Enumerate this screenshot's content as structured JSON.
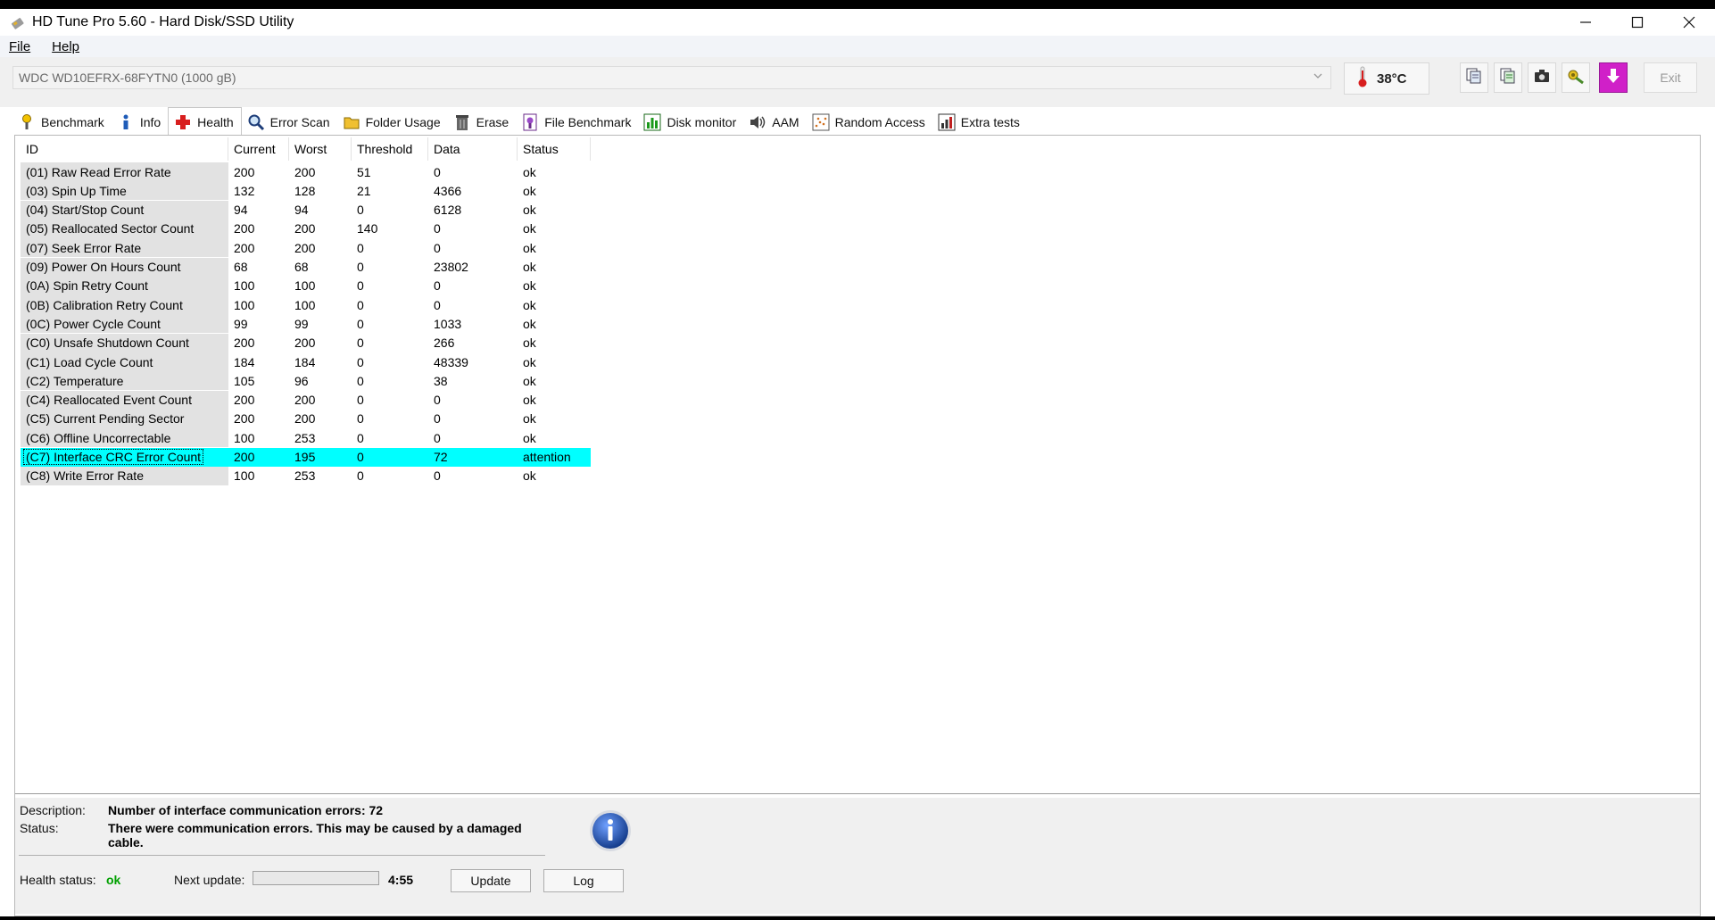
{
  "window": {
    "title": "HD Tune Pro 5.60 - Hard Disk/SSD Utility",
    "controls": {
      "minimize": "—",
      "maximize": "☐",
      "close": "✕"
    }
  },
  "menu": [
    {
      "label": "File"
    },
    {
      "label": "Help"
    }
  ],
  "drive": {
    "selected": "WDC WD10EFRX-68FYTN0 (1000 gB)"
  },
  "temperature": {
    "value": "38°C"
  },
  "toolbar": {
    "icons": [
      "copy-info-icon",
      "copy-all-icon",
      "screenshot-icon",
      "options-icon",
      "save-icon"
    ],
    "exit_label": "Exit"
  },
  "tabs": [
    {
      "label": "Benchmark",
      "icon": "benchmark-icon"
    },
    {
      "label": "Info",
      "icon": "info-icon"
    },
    {
      "label": "Health",
      "icon": "health-icon",
      "active": true
    },
    {
      "label": "Error Scan",
      "icon": "error-scan-icon"
    },
    {
      "label": "Folder Usage",
      "icon": "folder-usage-icon"
    },
    {
      "label": "Erase",
      "icon": "erase-icon"
    },
    {
      "label": "File Benchmark",
      "icon": "file-benchmark-icon"
    },
    {
      "label": "Disk monitor",
      "icon": "disk-monitor-icon"
    },
    {
      "label": "AAM",
      "icon": "aam-icon"
    },
    {
      "label": "Random Access",
      "icon": "random-access-icon"
    },
    {
      "label": "Extra tests",
      "icon": "extra-tests-icon"
    }
  ],
  "table": {
    "columns": [
      "ID",
      "Current",
      "Worst",
      "Threshold",
      "Data",
      "Status"
    ],
    "rows": [
      [
        "(01) Raw Read Error Rate",
        "200",
        "200",
        "51",
        "0",
        "ok"
      ],
      [
        "(03) Spin Up Time",
        "132",
        "128",
        "21",
        "4366",
        "ok"
      ],
      [
        "(04) Start/Stop Count",
        "94",
        "94",
        "0",
        "6128",
        "ok"
      ],
      [
        "(05) Reallocated Sector Count",
        "200",
        "200",
        "140",
        "0",
        "ok"
      ],
      [
        "(07) Seek Error Rate",
        "200",
        "200",
        "0",
        "0",
        "ok"
      ],
      [
        "(09) Power On Hours Count",
        "68",
        "68",
        "0",
        "23802",
        "ok"
      ],
      [
        "(0A) Spin Retry Count",
        "100",
        "100",
        "0",
        "0",
        "ok"
      ],
      [
        "(0B) Calibration Retry Count",
        "100",
        "100",
        "0",
        "0",
        "ok"
      ],
      [
        "(0C) Power Cycle Count",
        "99",
        "99",
        "0",
        "1033",
        "ok"
      ],
      [
        "(C0) Unsafe Shutdown Count",
        "200",
        "200",
        "0",
        "266",
        "ok"
      ],
      [
        "(C1) Load Cycle Count",
        "184",
        "184",
        "0",
        "48339",
        "ok"
      ],
      [
        "(C2) Temperature",
        "105",
        "96",
        "0",
        "38",
        "ok"
      ],
      [
        "(C4) Reallocated Event Count",
        "200",
        "200",
        "0",
        "0",
        "ok"
      ],
      [
        "(C5) Current Pending Sector",
        "200",
        "200",
        "0",
        "0",
        "ok"
      ],
      [
        "(C6) Offline Uncorrectable",
        "100",
        "253",
        "0",
        "0",
        "ok"
      ],
      [
        "(C7) Interface CRC Error Count",
        "200",
        "195",
        "0",
        "72",
        "attention"
      ],
      [
        "(C8) Write Error Rate",
        "100",
        "253",
        "0",
        "0",
        "ok"
      ]
    ],
    "selected_index": 15
  },
  "details": {
    "description_label": "Description:",
    "description": "Number of interface communication errors: 72",
    "status_label": "Status:",
    "status_line1": "There were communication errors. This may be caused by a damaged",
    "status_line2": "cable."
  },
  "footer": {
    "health_label": "Health status:",
    "health_value": "ok",
    "next_update_label": "Next update:",
    "progress_fraction": 0.0,
    "countdown": "4:55",
    "update_label": "Update",
    "log_label": "Log"
  },
  "colors": {
    "selection": "#00ffff",
    "id_column_bg": "#e2e2e2",
    "health_ok": "#00a000",
    "info_icon": "#1f4ea8"
  }
}
